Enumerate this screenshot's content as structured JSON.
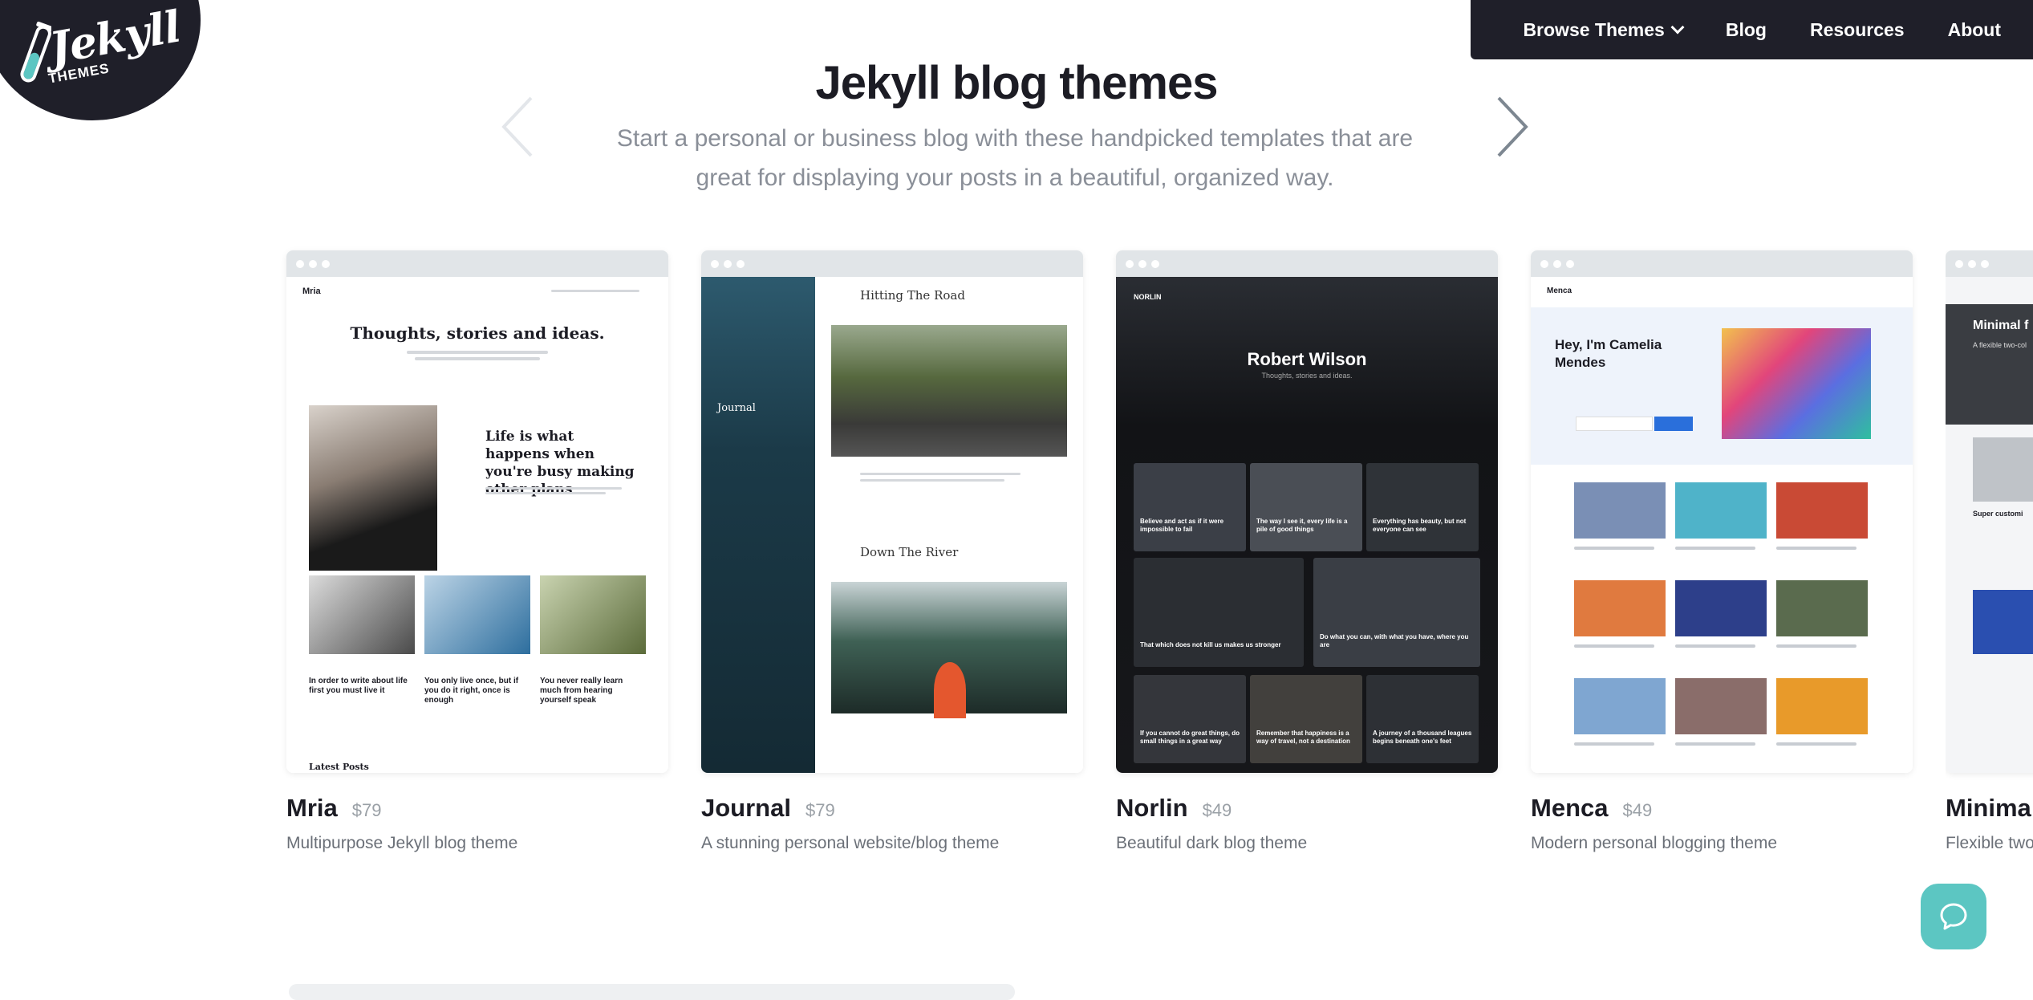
{
  "logo": {
    "word": "Jekyll",
    "sub": "THEMES"
  },
  "nav": {
    "items": [
      {
        "label": "Browse Themes",
        "dropdown": true
      },
      {
        "label": "Blog"
      },
      {
        "label": "Resources"
      },
      {
        "label": "About"
      }
    ]
  },
  "hero": {
    "title": "Jekyll blog themes",
    "subtitle": "Start a personal or business blog with these handpicked templates that are great for displaying your posts in a beautiful, organized way."
  },
  "carousel": {
    "prev_icon": "chevron-left-icon",
    "next_icon": "chevron-right-icon"
  },
  "themes": [
    {
      "name": "Mria",
      "price": "$79",
      "desc": "Multipurpose Jekyll blog theme",
      "preview": {
        "brand": "Mria",
        "headline": "Thoughts, stories and ideas.",
        "feature": "Life is what happens when you're busy making other plans",
        "posts": [
          "In order to write about life first you must live it",
          "You only live once, but if you do it right, once is enough",
          "You never really learn much from hearing yourself speak"
        ],
        "footer": "Latest Posts"
      }
    },
    {
      "name": "Journal",
      "price": "$79",
      "desc": "A stunning personal website/blog theme",
      "preview": {
        "sidebar_title": "Journal",
        "post1": "Hitting The Road",
        "post2": "Down The River"
      }
    },
    {
      "name": "Norlin",
      "price": "$49",
      "desc": "Beautiful dark blog theme",
      "preview": {
        "brand": "NORLIN",
        "hero": "Robert Wilson",
        "tagline": "Thoughts, stories and ideas.",
        "posts": [
          "Believe and act as if it were impossible to fail",
          "The way I see it, every life is a pile of good things",
          "Everything has beauty, but not everyone can see",
          "That which does not kill us makes us stronger",
          "Do what you can, with what you have, where you are",
          "If you cannot do great things, do small things in a great way",
          "Remember that happiness is a way of travel, not a destination",
          "A journey of a thousand leagues begins beneath one's feet"
        ]
      }
    },
    {
      "name": "Menca",
      "price": "$49",
      "desc": "Modern personal blogging theme",
      "preview": {
        "brand": "Menca",
        "hero": "Hey, I'm Camelia Mendes"
      }
    },
    {
      "name": "Minima",
      "price": "",
      "desc": "Flexible two",
      "preview": {
        "hero": "Minimal f",
        "text": "A flexible two-col",
        "card": "Super customi"
      }
    }
  ],
  "colors": {
    "dark": "#1f1f29",
    "accent": "#5cc6c2",
    "muted": "#8a8f98"
  },
  "help": {
    "icon": "chat-bubble-icon"
  }
}
